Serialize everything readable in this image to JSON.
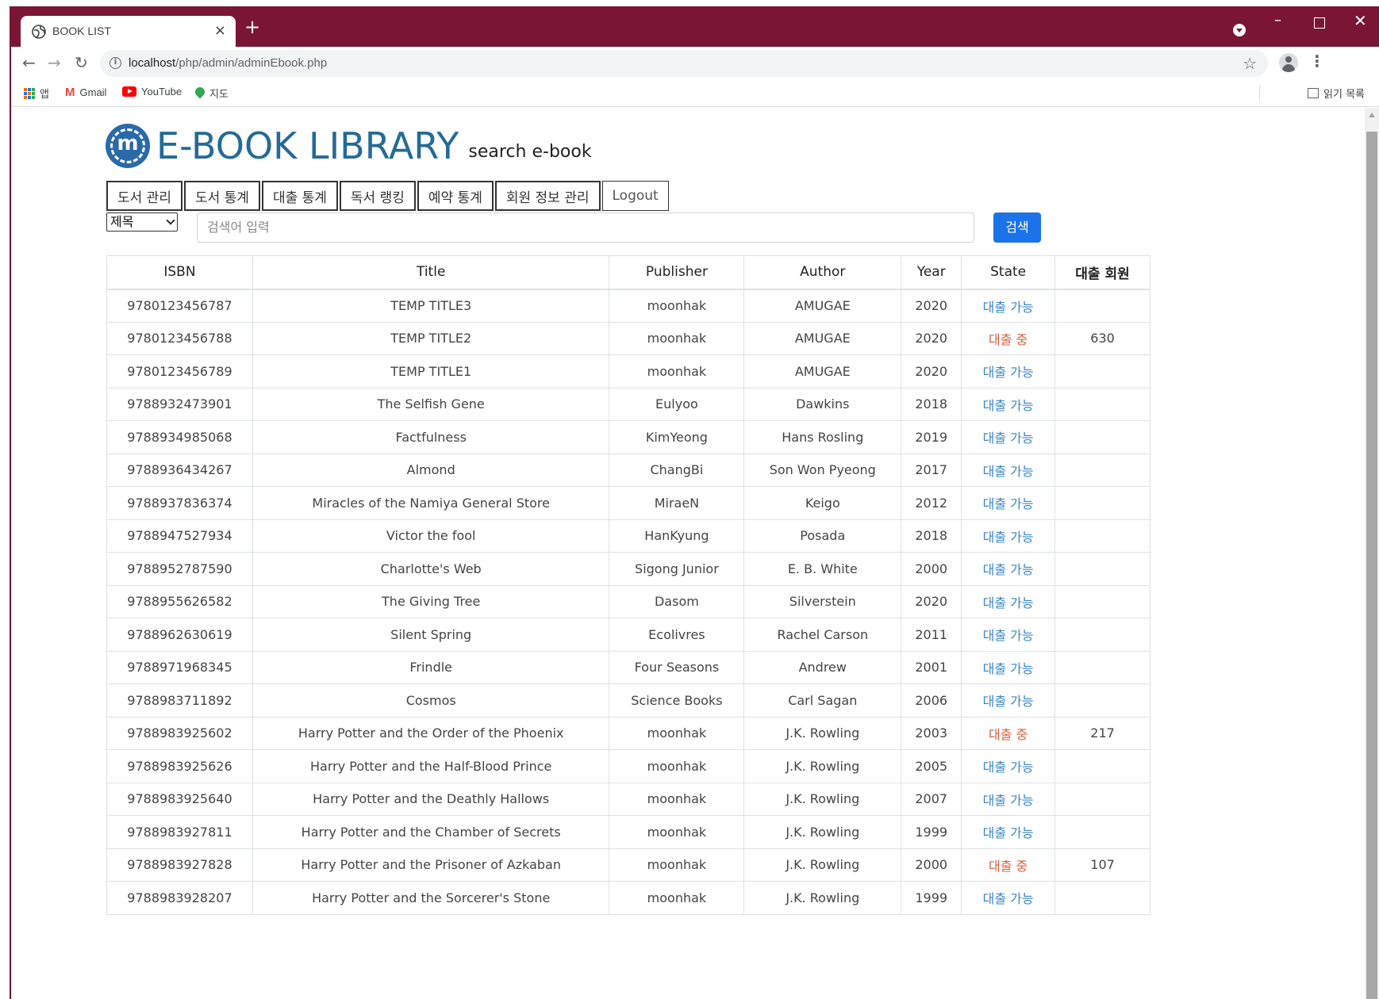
{
  "browser": {
    "tab_title": "BOOK LIST",
    "new_tab_label": "+",
    "url_host": "localhost",
    "url_path": "/php/admin/adminEbook.php",
    "bookmarks": [
      {
        "label": "앱",
        "icon": "apps-icon"
      },
      {
        "label": "Gmail",
        "icon": "gmail-icon"
      },
      {
        "label": "YouTube",
        "icon": "youtube-icon"
      },
      {
        "label": "지도",
        "icon": "maps-icon"
      }
    ],
    "reading_list": "읽기 목록",
    "accent_color": "#7b1535"
  },
  "header": {
    "brand": "E-BOOK LIBRARY",
    "tagline": "search e-book"
  },
  "menu": {
    "items": [
      "도서 관리",
      "도서 통계",
      "대출 통계",
      "독서 랭킹",
      "예약 통계",
      "회원 정보 관리"
    ],
    "logout": "Logout"
  },
  "search": {
    "select_value": "제목",
    "placeholder": "검색어 입력",
    "button": "검색"
  },
  "table": {
    "headers": [
      "ISBN",
      "Title",
      "Publisher",
      "Author",
      "Year",
      "State",
      "대출 회원"
    ],
    "status_colors": {
      "available": "#3a85c6",
      "loaned": "#d9603b"
    },
    "rows": [
      [
        "9780123456787",
        "TEMP TITLE3",
        "moonhak",
        "AMUGAE",
        "2020",
        "대출 가능",
        ""
      ],
      [
        "9780123456788",
        "TEMP TITLE2",
        "moonhak",
        "AMUGAE",
        "2020",
        "대출 중",
        "630"
      ],
      [
        "9780123456789",
        "TEMP TITLE1",
        "moonhak",
        "AMUGAE",
        "2020",
        "대출 가능",
        ""
      ],
      [
        "9788932473901",
        "The Selfish Gene",
        "Eulyoo",
        "Dawkins",
        "2018",
        "대출 가능",
        ""
      ],
      [
        "9788934985068",
        "Factfulness",
        "KimYeong",
        "Hans Rosling",
        "2019",
        "대출 가능",
        ""
      ],
      [
        "9788936434267",
        "Almond",
        "ChangBi",
        "Son Won Pyeong",
        "2017",
        "대출 가능",
        ""
      ],
      [
        "9788937836374",
        "Miracles of the Namiya General Store",
        "MiraeN",
        "Keigo",
        "2012",
        "대출 가능",
        ""
      ],
      [
        "9788947527934",
        "Victor the fool",
        "HanKyung",
        "Posada",
        "2018",
        "대출 가능",
        ""
      ],
      [
        "9788952787590",
        "Charlotte's Web",
        "Sigong Junior",
        "E. B. White",
        "2000",
        "대출 가능",
        ""
      ],
      [
        "9788955626582",
        "The Giving Tree",
        "Dasom",
        "Silverstein",
        "2020",
        "대출 가능",
        ""
      ],
      [
        "9788962630619",
        "Silent Spring",
        "Ecolivres",
        "Rachel Carson",
        "2011",
        "대출 가능",
        ""
      ],
      [
        "9788971968345",
        "Frindle",
        "Four Seasons",
        "Andrew",
        "2001",
        "대출 가능",
        ""
      ],
      [
        "9788983711892",
        "Cosmos",
        "Science Books",
        "Carl Sagan",
        "2006",
        "대출 가능",
        ""
      ],
      [
        "9788983925602",
        "Harry Potter and the Order of the Phoenix",
        "moonhak",
        "J.K. Rowling",
        "2003",
        "대출 중",
        "217"
      ],
      [
        "9788983925626",
        "Harry Potter and the Half-Blood Prince",
        "moonhak",
        "J.K. Rowling",
        "2005",
        "대출 가능",
        ""
      ],
      [
        "9788983925640",
        "Harry Potter and the Deathly Hallows",
        "moonhak",
        "J.K. Rowling",
        "2007",
        "대출 가능",
        ""
      ],
      [
        "9788983927811",
        "Harry Potter and the Chamber of Secrets",
        "moonhak",
        "J.K. Rowling",
        "1999",
        "대출 가능",
        ""
      ],
      [
        "9788983927828",
        "Harry Potter and the Prisoner of Azkaban",
        "moonhak",
        "J.K. Rowling",
        "2000",
        "대출 중",
        "107"
      ],
      [
        "9788983928207",
        "Harry Potter and the Sorcerer's Stone",
        "moonhak",
        "J.K. Rowling",
        "1999",
        "대출 가능",
        ""
      ]
    ]
  }
}
